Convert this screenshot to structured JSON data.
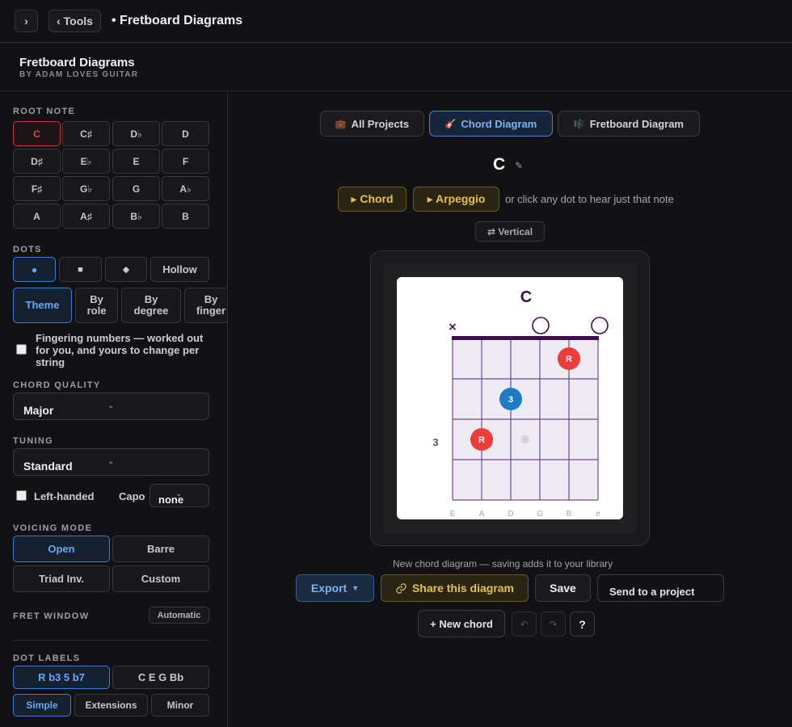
{
  "topbar": {
    "expand_icon": "chevron-right",
    "back_label": "‹ Tools",
    "crumb": "• Fretboard Diagrams"
  },
  "app": {
    "title": "Fretboard Diagrams",
    "subtitle": "BY ADAM LOVES GUITAR"
  },
  "sidebar": {
    "root_note_label": "ROOT NOTE",
    "root_notes": [
      "C",
      "C♯",
      "D♭",
      "D",
      "D♯",
      "E♭",
      "E",
      "F",
      "F♯",
      "G♭",
      "G",
      "A♭",
      "A",
      "A♯",
      "B♭",
      "B"
    ],
    "selected_root": "C",
    "dots_label": "DOTS",
    "dot_shapes": [
      "●",
      "■",
      "◆",
      "Hollow"
    ],
    "color_modes": [
      "Theme",
      "By role",
      "By degree",
      "By finger"
    ],
    "fingering_text": "Fingering numbers — worked out for you, and yours to change per string",
    "chord_quality_label": "CHORD QUALITY",
    "chord_quality_value": "Major",
    "tuning_label": "TUNING",
    "tuning_value": "Standard",
    "left_handed_label": "Left-handed",
    "capo_label": "Capo",
    "capo_value": "none",
    "voicing_label": "VOICING MODE",
    "voicings": [
      "Open",
      "Barre",
      "Triad Inv.",
      "Custom"
    ],
    "fret_window_label": "FRET WINDOW",
    "fret_window_value": "Automatic",
    "dot_labels_label": "DOT LABELS",
    "dot_label_modes": [
      "R b3 5 b7",
      "C E G Bb"
    ],
    "label_sets": [
      "Simple",
      "Extensions",
      "Minor"
    ]
  },
  "main": {
    "tabs": [
      {
        "icon": "💼",
        "label": "All Projects"
      },
      {
        "icon": "🎸",
        "label": "Chord Diagram"
      },
      {
        "icon": "🎼",
        "label": "Fretboard Diagram"
      }
    ],
    "chord_name": "C",
    "edit_icon": "✎",
    "play_chord": "▸ Chord",
    "play_arpeggio": "▸ Arpeggio",
    "play_hint": "or click any dot to hear just that note",
    "orientation_btn": "⇄ Vertical",
    "status_text": "New chord diagram — saving adds it to your library",
    "export_label": "Export",
    "share_label": "Share this diagram",
    "save_label": "Save",
    "send_placeholder": "Send to a project",
    "new_chord_label": "+ New chord",
    "undo_icon": "↶",
    "redo_icon": "↷",
    "help_label": "?"
  },
  "diagram": {
    "title": "C",
    "strings": [
      "E",
      "A",
      "D",
      "G",
      "B",
      "e"
    ],
    "fret_label": "3",
    "string_markers": [
      "x",
      "",
      "",
      "o",
      "",
      "o"
    ],
    "dots": [
      {
        "string": 5,
        "fret": 1,
        "label": "R",
        "role": "root"
      },
      {
        "string": 3,
        "fret": 2,
        "label": "3",
        "role": "third"
      },
      {
        "string": 2,
        "fret": 3,
        "label": "R",
        "role": "root"
      }
    ],
    "ghost_dots": [
      {
        "string": 3,
        "fret": 3
      }
    ],
    "colors": {
      "root": "#f03b3b",
      "third": "#1e7bc4",
      "ink": "#3c0f4a",
      "grid": "#6f4aa0",
      "board": "#eeebf2"
    }
  }
}
